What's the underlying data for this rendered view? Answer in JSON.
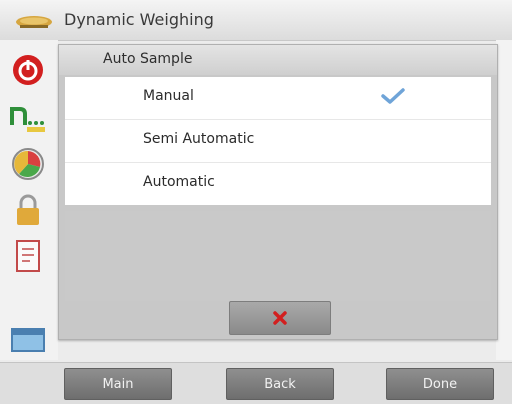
{
  "header": {
    "title": "Dynamic Weighing",
    "icon": "scale-pan-icon"
  },
  "sidebar": {
    "icons": [
      "power-icon",
      "application-icon",
      "gauge-icon",
      "lock-icon",
      "document-icon",
      "panel-icon"
    ]
  },
  "dialog": {
    "title": "Auto Sample",
    "options": [
      {
        "label": "Manual",
        "selected": true
      },
      {
        "label": "Semi Automatic",
        "selected": false
      },
      {
        "label": "Automatic",
        "selected": false
      }
    ],
    "cancel_icon": "cancel-x-icon"
  },
  "bottom_bar": {
    "main_label": "Main",
    "back_label": "Back",
    "done_label": "Done"
  },
  "colors": {
    "accent_red": "#d21f1f",
    "check_blue": "#6fa4d8",
    "button_gray": "#7b7b7b"
  }
}
